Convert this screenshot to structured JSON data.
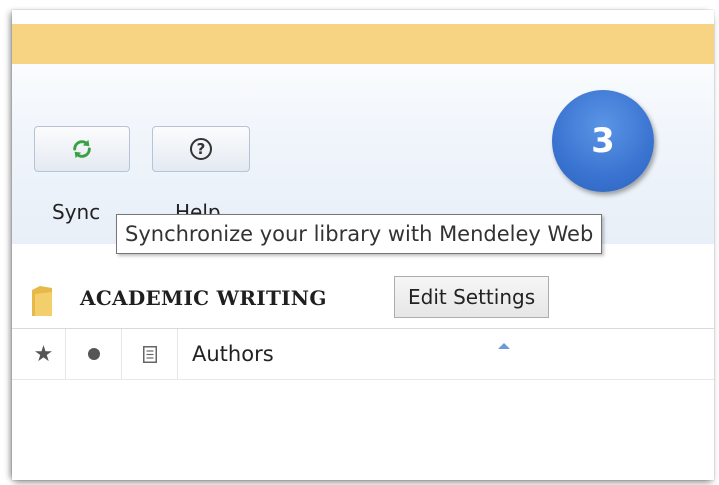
{
  "toolbar": {
    "sync_label": "Sync",
    "help_label": "Help",
    "sync_icon": "sync-icon",
    "help_icon": "help-icon",
    "help_glyph": "?"
  },
  "tooltip": {
    "text": "Synchronize your library with Mendeley Web"
  },
  "badge": {
    "number": "3",
    "color": "#3a74d1"
  },
  "folder": {
    "title": "ACADEMIC WRITING",
    "edit_settings_label": "Edit Settings"
  },
  "columns": {
    "star_icon": "star-icon",
    "read_status_icon": "dot-icon",
    "document_icon": "document-icon",
    "star_glyph": "★",
    "authors_label": "Authors"
  },
  "colors": {
    "top_bar": "#f6d484",
    "accent": "#3a74d1",
    "sync_icon_green": "#3aa043"
  }
}
